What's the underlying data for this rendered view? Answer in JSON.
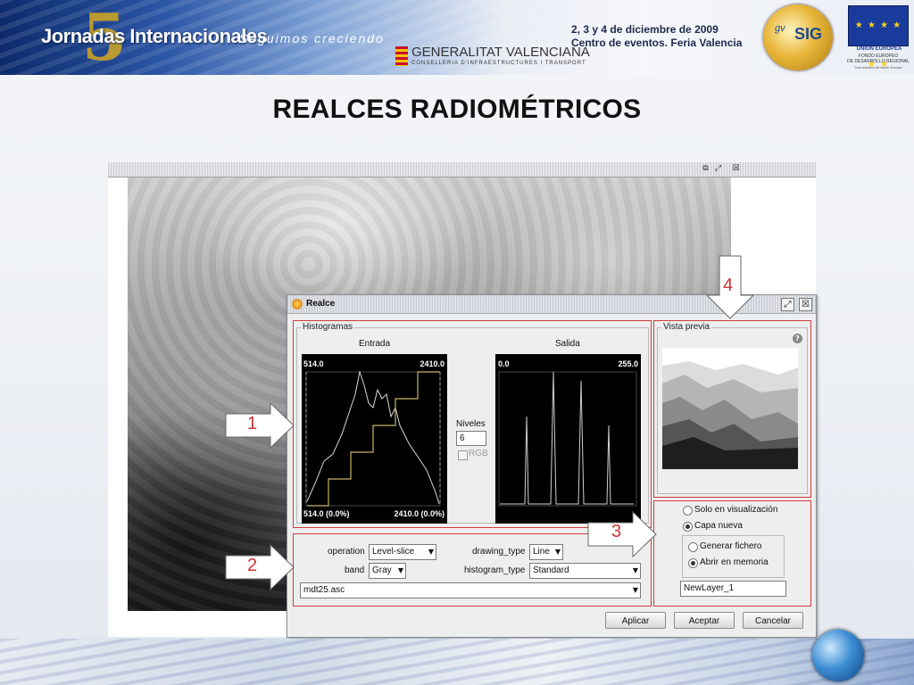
{
  "header": {
    "event_name": "Jornadas Internacionales",
    "event_number": "5",
    "slogan": "Seguimos creciendo",
    "sponsor_name": "GENERALITAT VALENCIANA",
    "sponsor_sub": "CONSELLERIA D'INFRAESTRUCTURES I TRANSPORT",
    "event_date": "2, 3 y 4 de diciembre de 2009",
    "event_place": "Centro de eventos. Feria Valencia",
    "gvsig_prefix": "gv",
    "gvsig_name": "SIG",
    "eu_title": "UNIÓN EUROPEA",
    "eu_sub1": "FONDO EUROPEO",
    "eu_sub2": "DE DESARROLLO REGIONAL",
    "eu_motto": "\"Una manera de hacer Europa\"",
    "eu_stars": "★ ★ ★ ★ ★ ★"
  },
  "slide": {
    "title": "REALCES RADIOMÉTRICOS"
  },
  "map_window": {
    "icons": [
      "restore-icon",
      "maximize-icon",
      "close-icon"
    ],
    "icon_glyphs": [
      "⧉",
      "⤢",
      "☒"
    ]
  },
  "realce": {
    "title": "Realce",
    "histograms_group": "Histogramas",
    "entrada_label": "Entrada",
    "salida_label": "Salida",
    "entrada_top_left": "514.0",
    "entrada_top_right": "2410.0",
    "entrada_bottom_left": "514.0 (0.0%)",
    "entrada_bottom_right": "2410.0 (0.0%)",
    "salida_top_left": "0.0",
    "salida_top_right": "255.0",
    "niveles_label": "Niveles",
    "niveles_value": "6",
    "rgb_label": "RGB",
    "preview_group": "Vista previa",
    "help_glyph": "?",
    "operation_label": "operation",
    "operation_value": "Level-slice",
    "drawing_type_label": "drawing_type",
    "drawing_type_value": "Line",
    "band_label": "band",
    "band_value": "Gray",
    "histogram_type_label": "histogram_type",
    "histogram_type_value": "Standard",
    "layer_value": "mdt25.asc",
    "solo_visualizacion": "Solo en visualización",
    "capa_nueva": "Capa nueva",
    "generar_fichero": "Generar fichero",
    "abrir_memoria": "Abrir en memoria",
    "new_layer_name": "NewLayer_1",
    "aplicar": "Aplicar",
    "aceptar": "Aceptar",
    "cancelar": "Cancelar",
    "dropdown_arrow": "▼",
    "selected_output": "capa_nueva",
    "selected_storage": "abrir_memoria"
  },
  "callouts": {
    "c1": "1",
    "c2": "2",
    "c3": "3",
    "c4": "4"
  },
  "colors": {
    "highlight_red": "#d23a3a",
    "callout_red": "#d03030"
  }
}
